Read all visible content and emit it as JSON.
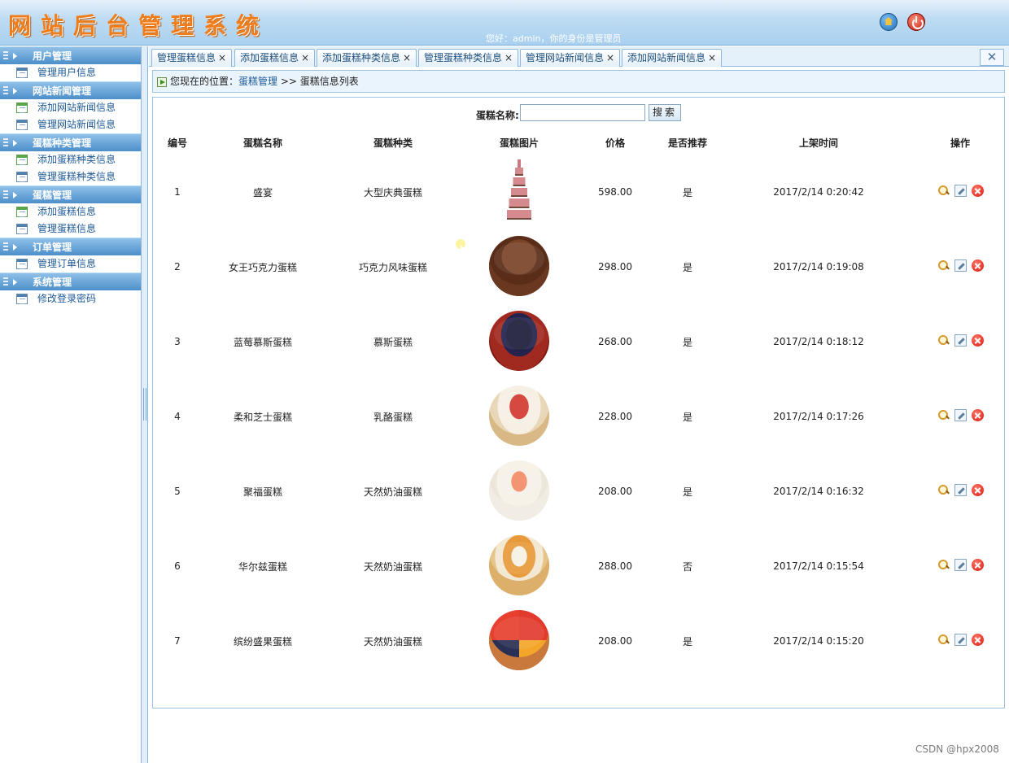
{
  "header": {
    "logo": "网站后台管理系统",
    "greeting": "您好：admin，你的身份是管理员",
    "icons": [
      "home-icon",
      "power-icon"
    ]
  },
  "sidebar": {
    "groups": [
      {
        "title": "用户管理",
        "items": [
          {
            "label": "管理用户信息",
            "icon": "list"
          }
        ]
      },
      {
        "title": "网站新闻管理",
        "items": [
          {
            "label": "添加网站新闻信息",
            "icon": "add"
          },
          {
            "label": "管理网站新闻信息",
            "icon": "list"
          }
        ]
      },
      {
        "title": "蛋糕种类管理",
        "items": [
          {
            "label": "添加蛋糕种类信息",
            "icon": "add"
          },
          {
            "label": "管理蛋糕种类信息",
            "icon": "list"
          }
        ]
      },
      {
        "title": "蛋糕管理",
        "items": [
          {
            "label": "添加蛋糕信息",
            "icon": "add"
          },
          {
            "label": "管理蛋糕信息",
            "icon": "list"
          }
        ]
      },
      {
        "title": "订单管理",
        "items": [
          {
            "label": "管理订单信息",
            "icon": "list"
          }
        ]
      },
      {
        "title": "系统管理",
        "items": [
          {
            "label": "修改登录密码",
            "icon": "list"
          }
        ]
      }
    ]
  },
  "tabs": [
    "管理蛋糕信息",
    "添加蛋糕信息",
    "添加蛋糕种类信息",
    "管理蛋糕种类信息",
    "管理网站新闻信息",
    "添加网站新闻信息"
  ],
  "breadcrumb": {
    "prefix": "您现在的位置：",
    "link": "蛋糕管理",
    "sep": " >> ",
    "current": "蛋糕信息列表"
  },
  "search": {
    "label": "蛋糕名称:",
    "value": "",
    "button": "搜索"
  },
  "table": {
    "headers": [
      "编号",
      "蛋糕名称",
      "蛋糕种类",
      "蛋糕图片",
      "价格",
      "是否推荐",
      "上架时间",
      "操作"
    ],
    "rows": [
      {
        "id": "1",
        "name": "盛宴",
        "type": "大型庆典蛋糕",
        "image": "tower",
        "price": "598.00",
        "recommend": "是",
        "time": "2017/2/14 0:20:42"
      },
      {
        "id": "2",
        "name": "女王巧克力蛋糕",
        "type": "巧克力风味蛋糕",
        "image": "choco",
        "price": "298.00",
        "recommend": "是",
        "time": "2017/2/14 0:19:08"
      },
      {
        "id": "3",
        "name": "蓝莓慕斯蛋糕",
        "type": "慕斯蛋糕",
        "image": "blue",
        "price": "268.00",
        "recommend": "是",
        "time": "2017/2/14 0:18:12"
      },
      {
        "id": "4",
        "name": "柔和芝士蛋糕",
        "type": "乳酪蛋糕",
        "image": "cheese",
        "price": "228.00",
        "recommend": "是",
        "time": "2017/2/14 0:17:26"
      },
      {
        "id": "5",
        "name": "聚福蛋糕",
        "type": "天然奶油蛋糕",
        "image": "fruit1",
        "price": "208.00",
        "recommend": "是",
        "time": "2017/2/14 0:16:32"
      },
      {
        "id": "6",
        "name": "华尔兹蛋糕",
        "type": "天然奶油蛋糕",
        "image": "fruit2",
        "price": "288.00",
        "recommend": "否",
        "time": "2017/2/14 0:15:54"
      },
      {
        "id": "7",
        "name": "缤纷盛果蛋糕",
        "type": "天然奶油蛋糕",
        "image": "fruit3",
        "price": "208.00",
        "recommend": "是",
        "time": "2017/2/14 0:15:20"
      }
    ]
  },
  "watermark": "CSDN @hpx2008",
  "colors": {
    "logo": "#f07d1b",
    "sidebar_header": "#4c8fca",
    "link": "#1e5a96"
  }
}
